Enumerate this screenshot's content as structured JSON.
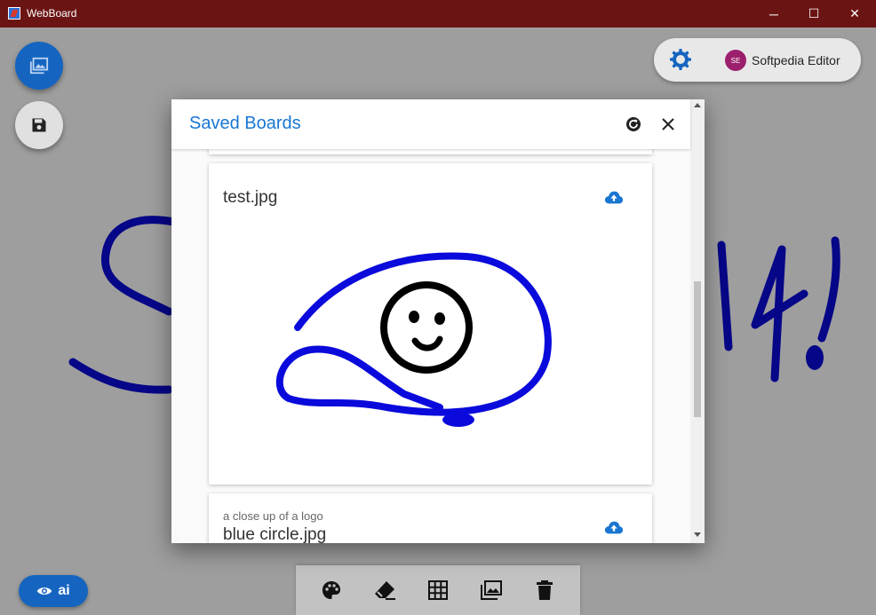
{
  "window": {
    "title": "WebBoard",
    "minimize_glyph": "─",
    "maximize_glyph": "☐",
    "close_glyph": "✕"
  },
  "user": {
    "initials": "SE",
    "name": "Softpedia Editor"
  },
  "visibility_chip": {
    "label": "ai"
  },
  "dialog": {
    "title": "Saved Boards",
    "boards": [
      {
        "name": "test.jpg",
        "description": ""
      },
      {
        "name": "blue circle.jpg",
        "description": "a close up of a logo"
      }
    ]
  },
  "toolbar": {
    "tools": [
      "palette-icon",
      "eraser-icon",
      "grid-icon",
      "image-icon",
      "delete-icon"
    ]
  },
  "colors": {
    "titlebar": "#6b1414",
    "accent": "#1565c0",
    "title_blue": "#1976d2",
    "stroke_blue": "#0a0adc"
  }
}
